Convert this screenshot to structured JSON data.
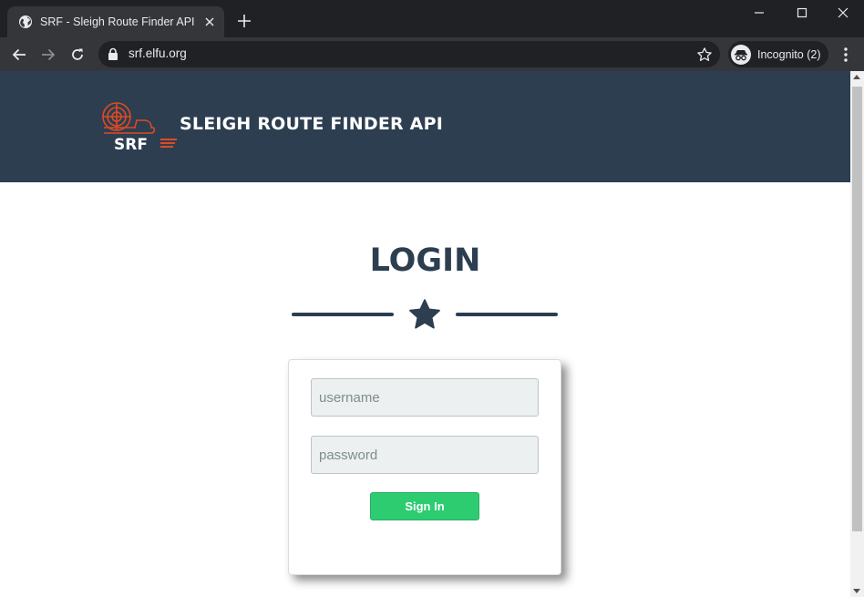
{
  "browser": {
    "tab": {
      "title": "SRF - Sleigh Route Finder API",
      "favicon": "globe-icon"
    },
    "url": "srf.elfu.org",
    "profile_label": "Incognito (2)",
    "accent_colors": {
      "frame": "#202124",
      "toolbar": "#35363a"
    }
  },
  "page": {
    "brand_mark": "SRF",
    "site_title": "SLEIGH ROUTE FINDER API",
    "login_heading": "LOGIN",
    "form": {
      "username_placeholder": "username",
      "password_placeholder": "password",
      "signin_label": "Sign In"
    },
    "colors": {
      "header_bg": "#2c3e50",
      "heading": "#2c3e50",
      "button": "#2ecc71",
      "logo": "#e04a22"
    }
  }
}
